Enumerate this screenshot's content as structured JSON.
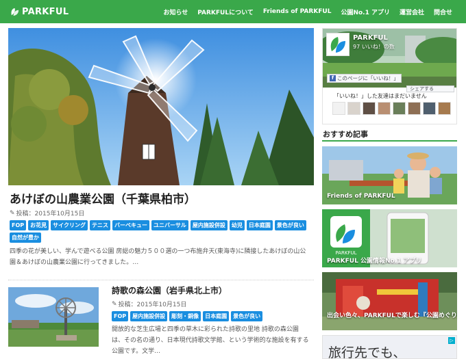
{
  "header": {
    "logo": "PARKFUL",
    "nav": [
      "お知らせ",
      "PARKFULについて",
      "Friends of PARKFUL",
      "公園No.1 アプリ",
      "運営会社",
      "問合せ"
    ]
  },
  "post1": {
    "title": "あけぼの山農業公園（千葉県柏市）",
    "date": "投稿：2015年10月15日",
    "tags_row1": [
      "FOP",
      "お花見",
      "サイクリング",
      "テニス",
      "バーベキュー",
      "ユニバーサル",
      "屋内施設併設",
      "幼児",
      "日本庭園",
      "景色が良い"
    ],
    "tags_row2": [
      "自然が豊か"
    ],
    "excerpt_line1": "四季の花が美しい、学んで遊べる公園 房総の魅力５００選の一つ布施弁天(東海寺)に隣接したあけぼの山公",
    "excerpt_line2": "園＆あけぼの山農業公園に行ってきました。…"
  },
  "post2": {
    "title": "詩歌の森公園（岩手県北上市）",
    "date": "投稿：2015年10月15日",
    "tags": [
      "FOP",
      "屋内施設併設",
      "彫刻・銅像",
      "日本庭園",
      "景色が良い"
    ],
    "excerpt_line1": "開放的な芝生広場と四季の草木に彩られた詩歌の里地 詩歌の森公園",
    "excerpt_line2": "は、その名の通り、日本現代詩歌文学館、という学術的な施設を有する",
    "excerpt_line3": "公園です。文学…"
  },
  "facebook": {
    "page_name": "PARKFUL",
    "likes": "97 いいね！の数",
    "like_button": "このページに「いいね！」",
    "share_button": "シェアする",
    "friends_note": "「いいね！」した友達はまだいません"
  },
  "sidebar": {
    "section_title": "おすすめ記事",
    "recs": [
      "Friends of PARKFUL",
      "PARKFUL 公園情報No.1 アプリ",
      "出会い色々、PARKFULで楽しむ『公園めぐり』"
    ],
    "ad_text": "旅行先でも、"
  },
  "colors": {
    "brand_green": "#3aa84a",
    "tag_blue": "#1a8ee0"
  }
}
